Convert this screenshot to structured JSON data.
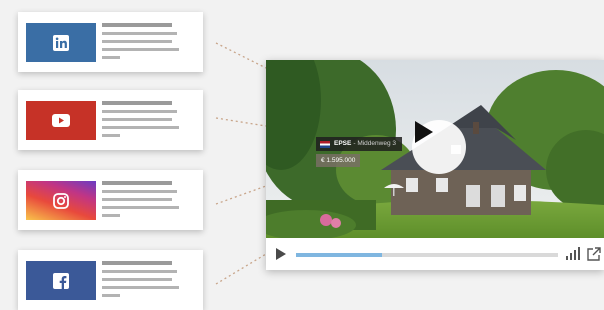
{
  "social_cards": [
    {
      "network": "LinkedIn",
      "icon": "linkedin-icon",
      "color": "#3a6ea5",
      "text_lines": 5
    },
    {
      "network": "YouTube",
      "icon": "youtube-icon",
      "color": "#c63227",
      "text_lines": 5
    },
    {
      "network": "Instagram",
      "icon": "instagram-icon",
      "color": "#c13584",
      "text_lines": 5
    },
    {
      "network": "Facebook",
      "icon": "facebook-icon",
      "color": "#3b5998",
      "text_lines": 5
    }
  ],
  "player": {
    "location_bold": "EPSE",
    "location_rest": "- Middenweg 3",
    "price": "€ 1.595.000",
    "progress": 0.33,
    "flag": "Netherlands"
  }
}
